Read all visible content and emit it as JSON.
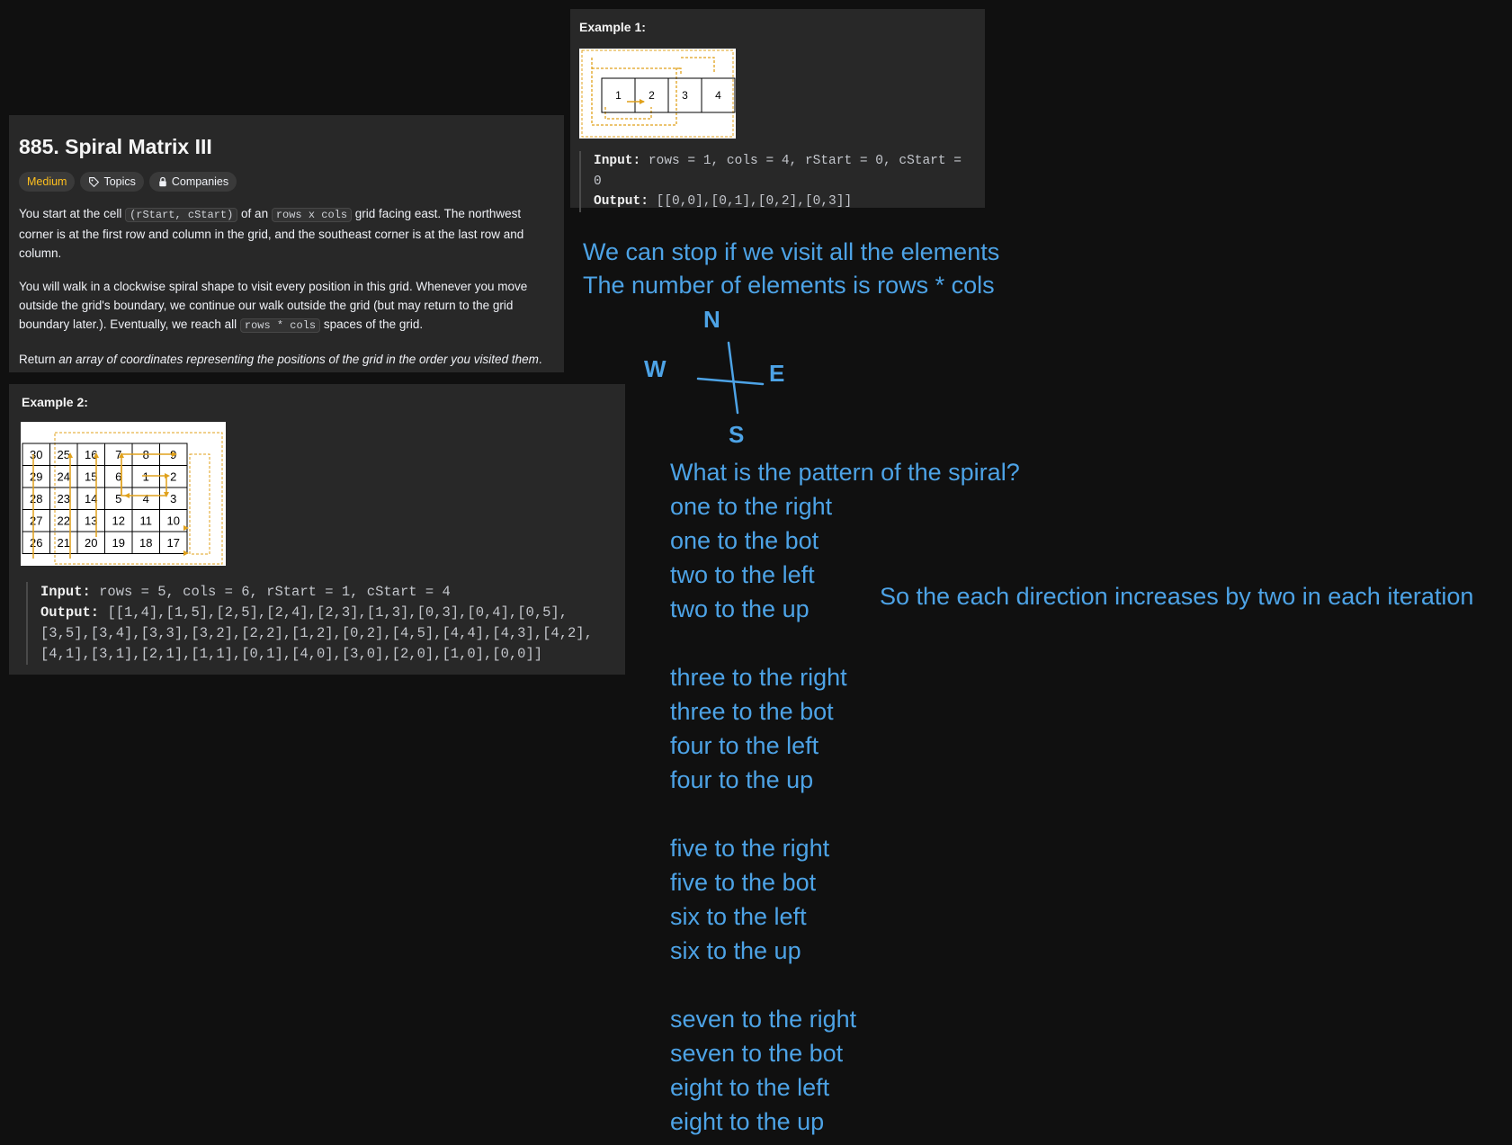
{
  "problem": {
    "title": "885. Spiral Matrix III",
    "difficulty": "Medium",
    "topics_label": "Topics",
    "companies_label": "Companies",
    "p1": {
      "t1": "You start at the cell ",
      "c1": "(rStart, cStart)",
      "t2": " of an ",
      "c2": "rows x cols",
      "t3": " grid facing east. The northwest corner is at the first row and column in the grid, and the southeast corner is at the last row and column."
    },
    "p2": {
      "t1": "You will walk in a clockwise spiral shape to visit every position in this grid. Whenever you move outside the grid's boundary, we continue our walk outside the grid (but may return to the grid boundary later.). Eventually, we reach all ",
      "c1": "rows * cols",
      "t2": " spaces of the grid."
    },
    "p3": {
      "t1": "Return ",
      "em": "an array of coordinates representing the positions of the grid in the order you visited them",
      "t2": "."
    }
  },
  "example1": {
    "title": "Example 1:",
    "cells": [
      "1",
      "2",
      "3",
      "4"
    ],
    "input_label": "Input:",
    "input": "rows = 1, cols = 4, rStart = 0, cStart = 0",
    "output_label": "Output:",
    "output": "[[0,0],[0,1],[0,2],[0,3]]"
  },
  "example2": {
    "title": "Example 2:",
    "grid": [
      [
        "30",
        "25",
        "16",
        "7",
        "8",
        "9"
      ],
      [
        "29",
        "24",
        "15",
        "6",
        "1",
        "2"
      ],
      [
        "28",
        "23",
        "14",
        "5",
        "4",
        "3"
      ],
      [
        "27",
        "22",
        "13",
        "12",
        "11",
        "10"
      ],
      [
        "26",
        "21",
        "20",
        "19",
        "18",
        "17"
      ]
    ],
    "input_label": "Input:",
    "input": "rows = 5, cols = 6, rStart = 1, cStart = 4",
    "output_label": "Output:",
    "output_lines": [
      "[[1,4],[1,5],[2,5],[2,4],[2,3],[1,3],[0,3],[0,4],[0,5],",
      "[3,5],[3,4],[3,3],[3,2],[2,2],[1,2],[0,2],[4,5],[4,4],[4,3],[4,2],",
      "[4,1],[3,1],[2,1],[1,1],[0,1],[4,0],[3,0],[2,0],[1,0],[0,0]]"
    ]
  },
  "notes": {
    "stop1": "We can stop if we visit all the elements",
    "stop2": "The number of elements is rows * cols",
    "compass": {
      "n": "N",
      "w": "W",
      "e": "E",
      "s": "S"
    },
    "pattern_question": "What is the pattern of the spiral?",
    "steps": [
      "one to the right",
      "one to the bot",
      "two to the left",
      "two to the up",
      "three to the right",
      "three to the bot",
      "four to the left",
      "four to the up",
      "five to the right",
      "five to the bot",
      "six to the left",
      "six to the up",
      "seven to the right",
      "seven to the bot",
      "eight to the left",
      "eight to the up"
    ],
    "increase": "So the each direction increases by two in each iteration"
  },
  "colors": {
    "background": "#101010",
    "panel": "#282828",
    "medium": "#ffc01e",
    "ink": "#4da3e6",
    "path": "#e0a11b"
  }
}
